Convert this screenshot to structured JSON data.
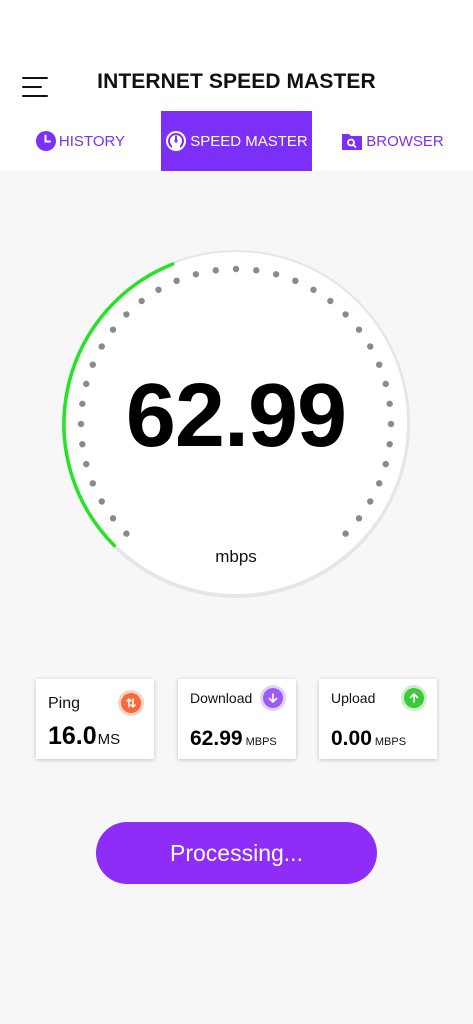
{
  "header": {
    "title": "INTERNET SPEED MASTER"
  },
  "tabs": [
    {
      "label": "HISTORY",
      "icon": "clock-icon",
      "active": false
    },
    {
      "label": "SPEED MASTER",
      "icon": "speedometer-icon",
      "active": true
    },
    {
      "label": "BROWSER",
      "icon": "folder-search-icon",
      "active": false
    }
  ],
  "gauge": {
    "value": "62.99",
    "unit": "mbps",
    "progress_fraction": 0.42,
    "progress_color": "#27e327"
  },
  "stats": {
    "ping": {
      "label": "Ping",
      "value": "16.0",
      "unit": "MS",
      "icon": "swap-arrows-icon"
    },
    "download": {
      "label": "Download",
      "value": "62.99",
      "unit": "MBPS",
      "icon": "arrow-down-icon"
    },
    "upload": {
      "label": "Upload",
      "value": "0.00",
      "unit": "MBPS",
      "icon": "arrow-up-icon"
    }
  },
  "action": {
    "label": "Processing..."
  },
  "colors": {
    "accent": "#7b2ff7",
    "button": "#8e2df7"
  }
}
